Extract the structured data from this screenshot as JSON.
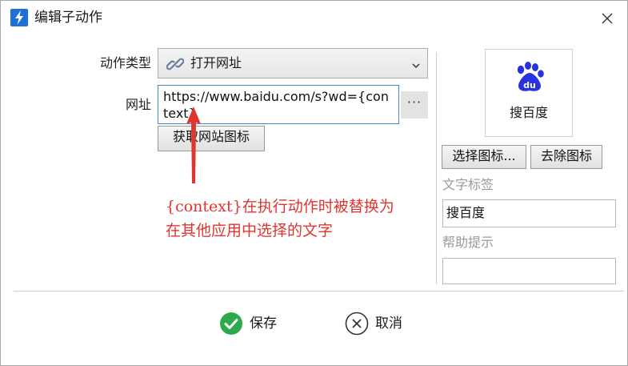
{
  "window": {
    "title": "编辑子动作",
    "app_icon": "lightning-bolt-icon",
    "close_icon": "close-icon"
  },
  "form": {
    "action_type_label": "动作类型",
    "action_type_value": "打开网址",
    "action_type_icon": "link-icon",
    "url_label": "网址",
    "url_value": "https://www.baidu.com/s?wd={context}",
    "more_button": "···",
    "fetch_favicon_button": "获取网站图标"
  },
  "annotation": {
    "line1": "{context}在执行动作时被替换为",
    "line2": "在其他应用中选择的文字",
    "color": "#e0352f"
  },
  "icon_panel": {
    "preview_icon": "baidu-paw-icon",
    "preview_label": "搜百度",
    "choose_icon_button": "选择图标...",
    "remove_icon_button": "去除图标",
    "text_tag_label": "文字标签",
    "text_tag_value": "搜百度",
    "help_label": "帮助提示",
    "help_value": ""
  },
  "footer": {
    "save_label": "保存",
    "save_icon": "check-circle-icon",
    "save_color": "#2eaa4d",
    "cancel_label": "取消",
    "cancel_icon": "x-circle-icon"
  },
  "colors": {
    "accent_border": "#3c8ad8",
    "baidu_blue": "#2932e1"
  }
}
